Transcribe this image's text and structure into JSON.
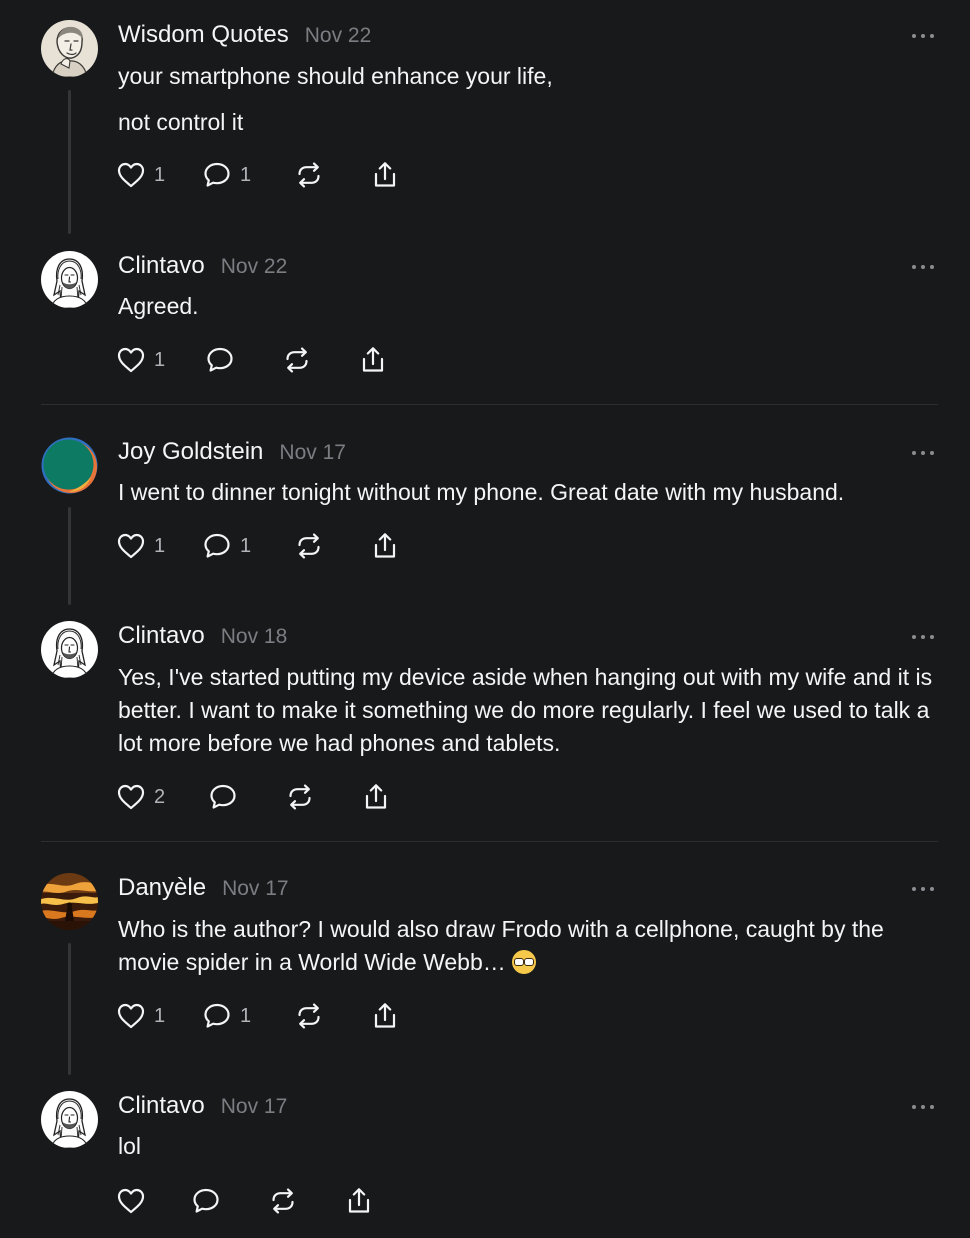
{
  "posts": [
    {
      "author": "Wisdom Quotes",
      "date": "Nov 22",
      "lines": [
        "your smartphone should enhance your life,",
        "not control it"
      ],
      "likes": "1",
      "replies": "1",
      "avatar": "sketch-portrait-man"
    },
    {
      "author": "Clintavo",
      "date": "Nov 22",
      "lines": [
        "Agreed."
      ],
      "likes": "1",
      "replies": "",
      "avatar": "sketch-portrait-long-hair"
    },
    {
      "author": "Joy Goldstein",
      "date": "Nov 17",
      "lines": [
        "I went to dinner tonight without my phone. Great date with my husband."
      ],
      "likes": "1",
      "replies": "1",
      "avatar": "teal-orange-circle"
    },
    {
      "author": "Clintavo",
      "date": "Nov 18",
      "lines": [
        "Yes, I've started putting my device aside when hanging out with my wife and it is better. I want to make it something we do more regularly. I feel we used to talk a lot more before we had phones and tablets."
      ],
      "likes": "2",
      "replies": "",
      "avatar": "sketch-portrait-long-hair"
    },
    {
      "author": "Danyèle",
      "date": "Nov 17",
      "lines": [
        "Who is the author? I would also draw Frodo with a cellphone, caught by the movie spider in a World Wide Webb… "
      ],
      "emoji": "nerd-face",
      "likes": "1",
      "replies": "1",
      "avatar": "sunset-silhouette"
    },
    {
      "author": "Clintavo",
      "date": "Nov 17",
      "lines": [
        "lol"
      ],
      "likes": "",
      "replies": "",
      "avatar": "sketch-portrait-long-hair"
    }
  ],
  "icons": {
    "like": "heart-icon",
    "reply": "comment-bubble-icon",
    "repost": "repost-arrows-icon",
    "share": "share-icon",
    "more": "more-dots-icon"
  },
  "colors": {
    "background": "#18191b",
    "text": "#f3f5f7",
    "muted": "#7a7d82",
    "divider": "#2c2e31"
  }
}
